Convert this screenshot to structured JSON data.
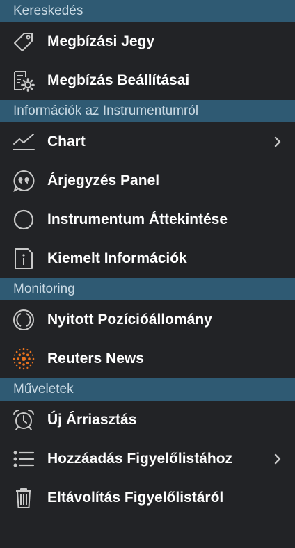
{
  "colors": {
    "header_bg": "#2f5a73",
    "panel_bg": "#222326",
    "text": "#ffffff",
    "icon": "#c9c9c9",
    "reuters": "#e8731e"
  },
  "sections": [
    {
      "title": "Kereskedés",
      "items": [
        {
          "label": "Megbízási Jegy",
          "icon": "tag-icon"
        },
        {
          "label": "Megbízás Beállításai",
          "icon": "order-settings-icon"
        }
      ]
    },
    {
      "title": "Információk az Instrumentumról",
      "items": [
        {
          "label": "Chart",
          "icon": "chart-icon",
          "submenu": true
        },
        {
          "label": "Árjegyzés Panel",
          "icon": "quote-icon"
        },
        {
          "label": "Instrumentum Áttekintése",
          "icon": "circle-icon"
        },
        {
          "label": "Kiemelt Információk",
          "icon": "info-icon"
        }
      ]
    },
    {
      "title": "Monitoring",
      "items": [
        {
          "label": "Nyitott Pozícióállomány",
          "icon": "positions-icon"
        },
        {
          "label": "Reuters News",
          "icon": "reuters-icon"
        }
      ]
    },
    {
      "title": "Műveletek",
      "items": [
        {
          "label": "Új Árriasztás",
          "icon": "alarm-clock-icon"
        },
        {
          "label": "Hozzáadás Figyelőlistához",
          "icon": "list-icon",
          "submenu": true
        },
        {
          "label": "Eltávolítás Figyelőlistáról",
          "icon": "trash-icon"
        }
      ]
    }
  ]
}
